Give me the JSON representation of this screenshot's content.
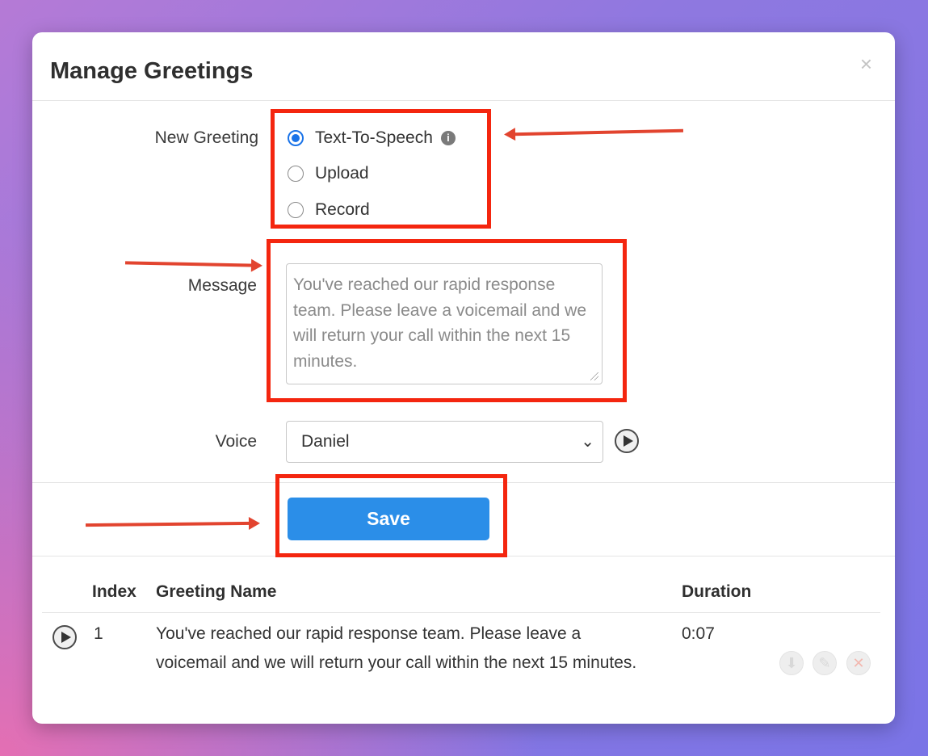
{
  "modal": {
    "title": "Manage Greetings",
    "close_glyph": "×"
  },
  "form": {
    "new_greeting_label": "New Greeting",
    "options": [
      {
        "label": "Text-To-Speech",
        "checked": true
      },
      {
        "label": "Upload",
        "checked": false
      },
      {
        "label": "Record",
        "checked": false
      }
    ],
    "info_glyph": "i",
    "message_label": "Message",
    "message_text": "You've reached our rapid response team. Please leave a voicemail and we will return your call within the next 15 minutes.",
    "voice_label": "Voice",
    "voice_value": "Daniel",
    "chevron_glyph": "⌄",
    "save_label": "Save"
  },
  "table": {
    "headers": {
      "index": "Index",
      "name": "Greeting Name",
      "duration": "Duration"
    },
    "rows": [
      {
        "index": "1",
        "name": "You've reached our rapid response team. Please leave a voicemail and we will return your call within the next 15 minutes.",
        "duration": "0:07"
      }
    ],
    "action_icons": [
      "download-icon",
      "edit-icon",
      "delete-icon"
    ],
    "action_glyphs": {
      "download": "⬇",
      "edit": "✎",
      "delete": "✕"
    }
  },
  "annotation_color": "#f4260f",
  "accent_color": "#2b8ee8"
}
